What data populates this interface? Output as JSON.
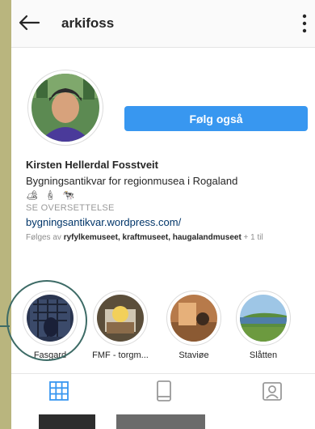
{
  "header": {
    "username": "arkifoss",
    "back_icon": "arrow-left-icon",
    "menu_icon": "kebab-icon"
  },
  "profile": {
    "follow_label": "Følg også",
    "name": "Kirsten Hellerdal Fosstveit",
    "description": "Bygningsantikvar for regionmusea i Rogaland",
    "emoji_line": "🏕 🕯 🐄",
    "translate": "SE OVERSETTELSE",
    "website": "bygningsantikvar.wordpress.com/",
    "followed_prefix": "Følges av ",
    "followed_accounts": "ryfylkemuseet, kraftmuseet, haugalandmuseet",
    "followed_suffix": " + 1 til"
  },
  "highlights": [
    {
      "label": "Fasgard"
    },
    {
      "label": "FMF - torgm..."
    },
    {
      "label": "Staviøe"
    },
    {
      "label": "Slåtten"
    }
  ],
  "tabs": [
    {
      "icon": "grid-icon",
      "active": true
    },
    {
      "icon": "feed-icon",
      "active": false
    },
    {
      "icon": "tagged-icon",
      "active": false
    }
  ],
  "colors": {
    "accent": "#3897f0",
    "annotation": "#3d6b66",
    "background": "#b9b57e"
  }
}
